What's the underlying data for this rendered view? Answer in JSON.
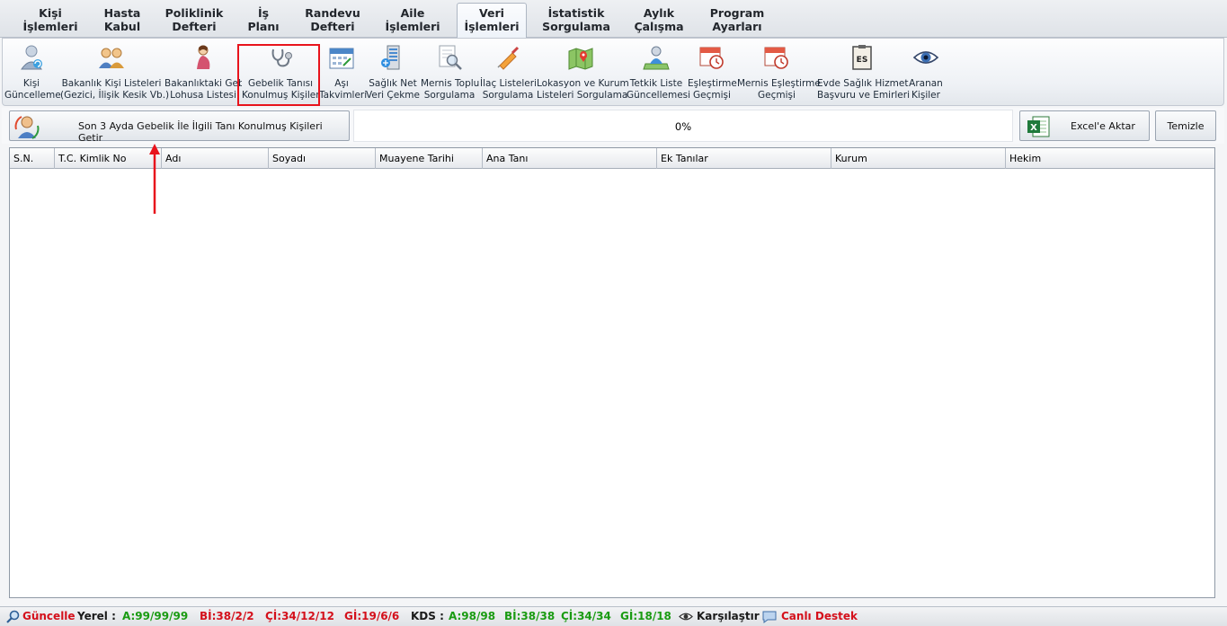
{
  "tabs": [
    {
      "line1": "Kişi",
      "line2": "İşlemleri"
    },
    {
      "line1": "Hasta",
      "line2": "Kabul"
    },
    {
      "line1": "Poliklinik",
      "line2": "Defteri"
    },
    {
      "line1": "İş",
      "line2": "Planı"
    },
    {
      "line1": "Randevu",
      "line2": "Defteri"
    },
    {
      "line1": "Aile",
      "line2": "İşlemleri"
    },
    {
      "line1": "Veri",
      "line2": "İşlemleri"
    },
    {
      "line1": "İstatistik",
      "line2": "Sorgulama"
    },
    {
      "line1": "Aylık",
      "line2": "Çalışma"
    },
    {
      "line1": "Program",
      "line2": "Ayarları"
    }
  ],
  "ribbon": [
    {
      "line1": "Kişi",
      "line2": "Güncelleme",
      "icon": "person-refresh-icon"
    },
    {
      "line1": "Bakanlık Kişi Listeleri",
      "line2": "(Gezici, İlişik Kesik Vb.)",
      "icon": "people-group-icon"
    },
    {
      "line1": "Bakanlıktaki Gebe",
      "line2": "Lohusa Listesi",
      "icon": "pregnant-woman-icon"
    },
    {
      "line1": "Gebelik Tanısı",
      "line2": "Konulmuş Kişiler",
      "icon": "stethoscope-icon"
    },
    {
      "line1": "Aşı",
      "line2": "Takvimleri",
      "icon": "calendar-icon"
    },
    {
      "line1": "Sağlık Net",
      "line2": "Veri Çekme",
      "icon": "server-icon"
    },
    {
      "line1": "Mernis Toplu",
      "line2": "Sorgulama",
      "icon": "magnifier-doc-icon"
    },
    {
      "line1": "İlaç Listeleri",
      "line2": "Sorgulama",
      "icon": "syringe-icon"
    },
    {
      "line1": "Lokasyon ve Kurum",
      "line2": "Listeleri Sorgulama",
      "icon": "map-icon"
    },
    {
      "line1": "Tetkik Liste",
      "line2": "Güncellemesi",
      "icon": "person-map-icon"
    },
    {
      "line1": "Eşleştirme",
      "line2": "Geçmişi",
      "icon": "calendar-clock-icon"
    },
    {
      "line1": "Mernis Eşleştirme",
      "line2": "Geçmişi",
      "icon": "calendar-clock-icon"
    },
    {
      "line1": "Evde Sağlık Hizmet",
      "line2": "Başvuru ve Emirleri",
      "icon": "es-clipboard-icon"
    },
    {
      "line1": "Aranan",
      "line2": "Kişiler",
      "icon": "eye-icon"
    }
  ],
  "actions": {
    "fetch_label": "Son 3 Ayda Gebelik İle İlgili Tanı Konulmuş Kişileri Getir",
    "progress_text": "0%",
    "excel_label": "Excel'e Aktar",
    "clear_label": "Temizle"
  },
  "grid": {
    "columns": [
      "S.N.",
      "T.C. Kimlik No",
      "Adı",
      "Soyadı",
      "Muayene Tarihi",
      "Ana Tanı",
      "Ek Tanılar",
      "Kurum",
      "Hekim"
    ],
    "rows": []
  },
  "status": {
    "guncelle": "Güncelle",
    "yerel_label": "Yerel :",
    "yerel_a": "A:99/99/99",
    "yerel_bi": "Bİ:38/2/2",
    "yerel_ci": "Çİ:34/12/12",
    "yerel_gi": "Gİ:19/6/6",
    "kds_label": "KDS :",
    "kds_a": "A:98/98",
    "kds_bi": "Bİ:38/38",
    "kds_ci": "Çİ:34/34",
    "kds_gi": "Gİ:18/18",
    "compare": "Karşılaştır",
    "support": "Canlı Destek"
  }
}
